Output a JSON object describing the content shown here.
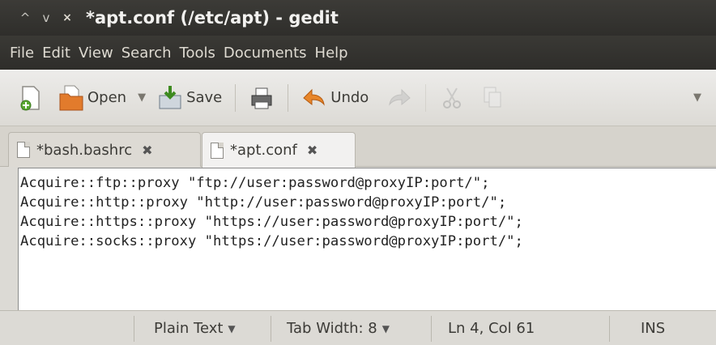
{
  "window": {
    "controls": [
      "^",
      "v",
      "×"
    ],
    "title": "*apt.conf (/etc/apt) - gedit"
  },
  "menu": [
    "File",
    "Edit",
    "View",
    "Search",
    "Tools",
    "Documents",
    "Help"
  ],
  "toolbar": {
    "new_icon": "new-document-icon",
    "open_label": "Open",
    "save_label": "Save",
    "undo_label": "Undo",
    "overflow_arrow": "▼",
    "open_arrow": "▼"
  },
  "tabs": [
    {
      "label": "*bash.bashrc",
      "close": "✖",
      "active": false
    },
    {
      "label": "*apt.conf",
      "close": "✖",
      "active": true
    }
  ],
  "editor": {
    "lines": [
      "Acquire::ftp::proxy \"ftp://user:password@proxyIP:port/\";",
      "Acquire::http::proxy \"http://user:password@proxyIP:port/\";",
      "Acquire::https::proxy \"https://user:password@proxyIP:port/\";",
      "Acquire::socks::proxy \"https://user:password@proxyIP:port/\";"
    ]
  },
  "status": {
    "language": "Plain Text",
    "tab_width": "Tab Width: 8",
    "position": "Ln 4, Col 61",
    "mode": "INS",
    "dropdown_arrow": "▼"
  },
  "colors": {
    "titlebar": "#3c3b37",
    "toolbar": "#edecea",
    "editor_bg": "#ffffff",
    "undo_arrow": "#e8862a"
  }
}
